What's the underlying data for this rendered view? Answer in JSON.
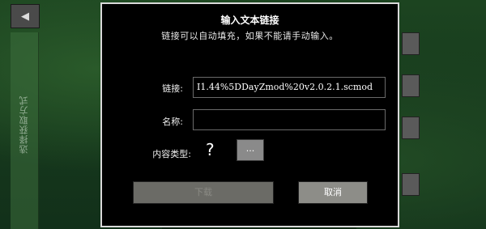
{
  "sidebar": {
    "back_icon": "back-arrow-icon",
    "back_glyph": "◀",
    "tab_label": "选择获取方式"
  },
  "dialog": {
    "title": "输入文本链接",
    "subtitle": "链接可以自动填充，如果不能请手动输入。",
    "link": {
      "label": "链接:",
      "value": "I1.44%5DDayZmod%20v2.0.2.1.scmod"
    },
    "name": {
      "label": "名称:",
      "value": ""
    },
    "content_type": {
      "label": "内容类型:",
      "icon": "question-mark-icon",
      "glyph": "?",
      "more_label": "..."
    },
    "confirm_label": "下载",
    "cancel_label": "取消"
  },
  "colors": {
    "dialog_bg": "#000000",
    "dialog_border": "#d9d9d9",
    "button_disabled": "#6b6b66",
    "button_enabled": "#8d8d88",
    "background": "#1c4420"
  }
}
